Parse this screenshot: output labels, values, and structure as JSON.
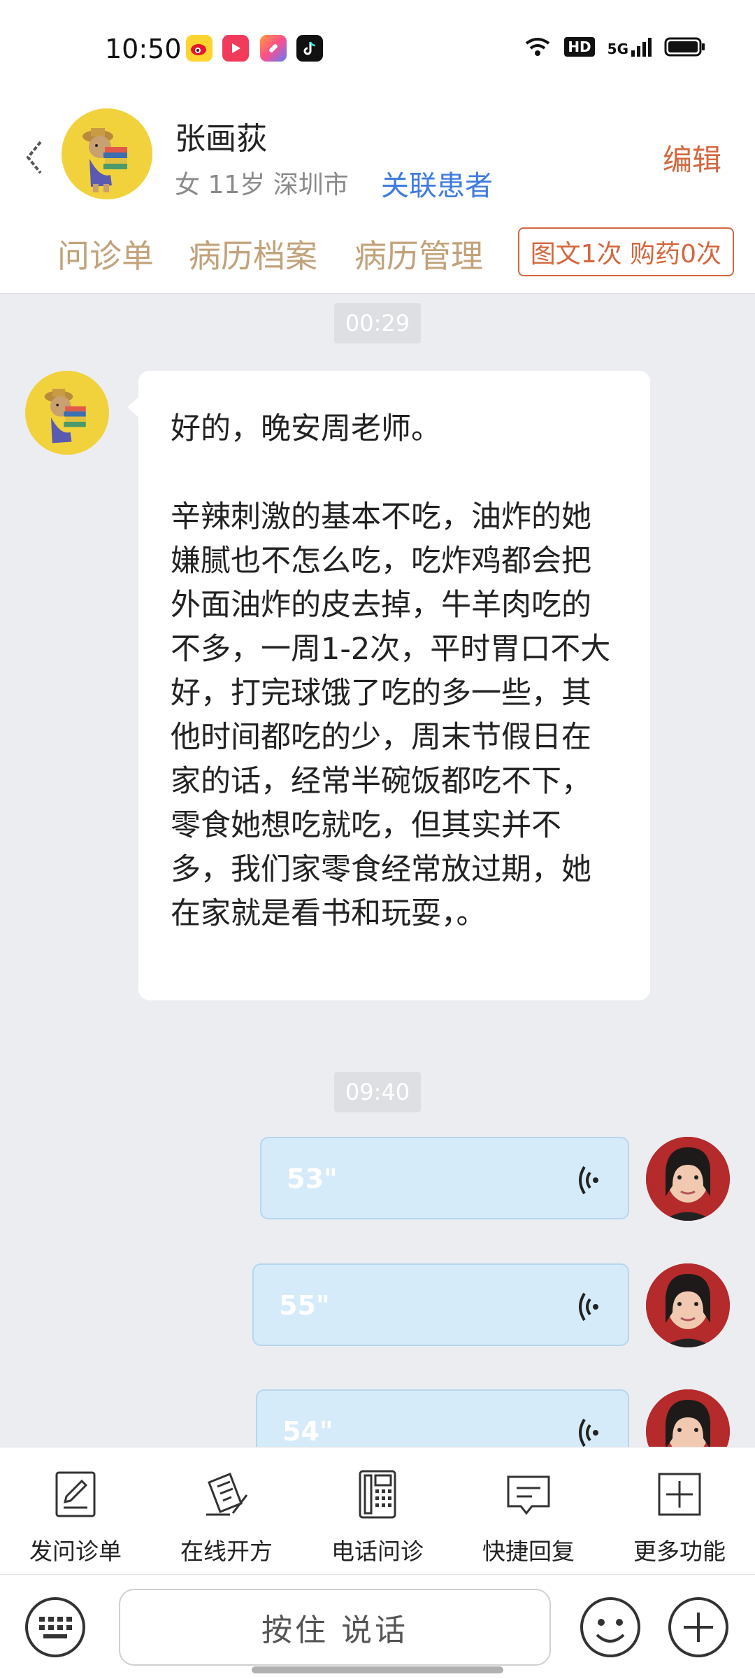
{
  "status_bar": {
    "time": "10:50",
    "apps": [
      "weibo-icon",
      "video-icon",
      "shortcut-icon",
      "tiktok-icon"
    ],
    "hd_label": "HD",
    "network_label": "5G"
  },
  "header": {
    "name": "张画荻",
    "meta": "女 11岁  深圳市",
    "link_patient": "关联患者",
    "edit": "编辑",
    "tabs": [
      "问诊单",
      "病历档案",
      "病历管理"
    ],
    "count_badge": "图文1次 购药0次"
  },
  "chat": {
    "timestamp_1": "00:29",
    "message_1": "好的，晚安周老师。\n\n辛辣刺激的基本不吃，油炸的她嫌腻也不怎么吃，吃炸鸡都会把外面油炸的皮去掉，牛羊肉吃的不多，一周1-2次，平时胃口不大好，打完球饿了吃的多一些，其他时间都吃的少，周末节假日在家的话，经常半碗饭都吃不下，零食她想吃就吃，但其实并不多，我们家零食经常放过期，她在家就是看书和玩耍，。",
    "timestamp_2": "09:40",
    "voices": [
      {
        "duration": "53\""
      },
      {
        "duration": "55\""
      },
      {
        "duration": "54\""
      }
    ]
  },
  "functions": [
    {
      "label": "发问诊单",
      "icon": "form-icon"
    },
    {
      "label": "在线开方",
      "icon": "prescription-icon"
    },
    {
      "label": "电话问诊",
      "icon": "phone-icon"
    },
    {
      "label": "快捷回复",
      "icon": "quick-reply-icon"
    },
    {
      "label": "更多功能",
      "icon": "more-icon"
    }
  ],
  "input": {
    "hold_to_talk": "按住 说话"
  },
  "colors": {
    "accent_orange": "#d4673e",
    "link_blue": "#3f7be0",
    "tab_tan": "#c2a27a",
    "voice_bubble": "#d6ebfa"
  }
}
